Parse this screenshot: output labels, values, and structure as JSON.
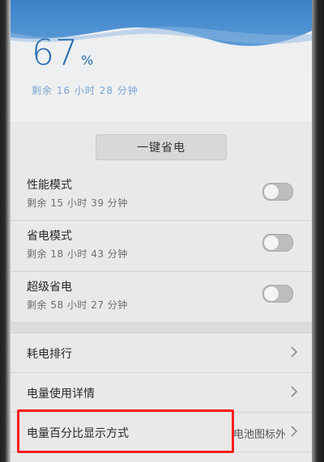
{
  "battery": {
    "percent": "67",
    "unit": "%",
    "remaining": "剩余 16 小时 28 分钟",
    "level_fraction": 0.67
  },
  "one_key_save": {
    "label": "一键省电"
  },
  "modes": [
    {
      "title": "性能模式",
      "remaining": "剩余 15 小时 39 分钟",
      "enabled": false
    },
    {
      "title": "省电模式",
      "remaining": "剩余 18 小时 43 分钟",
      "enabled": false
    },
    {
      "title": "超级省电",
      "remaining": "剩余 58 小时 27 分钟",
      "enabled": false
    }
  ],
  "rows": [
    {
      "label": "耗电排行",
      "value": ""
    },
    {
      "label": "电量使用详情",
      "value": ""
    },
    {
      "label": "电量百分比显示方式",
      "value": "电池图标外"
    }
  ],
  "icons": {
    "chevron": "chevron-right-icon",
    "toggle": "toggle-switch"
  },
  "colors": {
    "accent": "#2d6fb4",
    "highlight": "#ff1e1e"
  }
}
